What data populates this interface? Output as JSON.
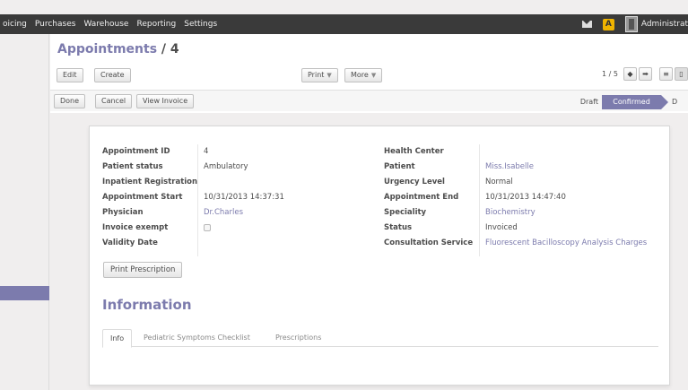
{
  "topbar": {
    "menu": [
      "oicing",
      "Purchases",
      "Warehouse",
      "Reporting",
      "Settings"
    ],
    "user": "Administrat",
    "alert_symbol": "A"
  },
  "header": {
    "title": "Appointments",
    "record": "4",
    "separator": " / ",
    "buttons": {
      "edit": "Edit",
      "create": "Create",
      "print": "Print",
      "more": "More"
    },
    "pager": "1 / 5",
    "prev_symbol": "◆",
    "next_symbol": "➡"
  },
  "statusbar": {
    "done": "Done",
    "cancel": "Cancel",
    "view_invoice": "View Invoice",
    "stages": [
      "Draft",
      "Confirmed",
      "D"
    ]
  },
  "form": {
    "left": [
      {
        "label": "Appointment ID",
        "value": "4"
      },
      {
        "label": "Patient status",
        "value": "Ambulatory"
      },
      {
        "label": "Inpatient Registration",
        "value": ""
      },
      {
        "label": "Appointment Start",
        "value": "10/31/2013 14:37:31"
      },
      {
        "label": "Physician",
        "value": "Dr.Charles"
      },
      {
        "label": "Invoice exempt",
        "value": ""
      },
      {
        "label": "Validity Date",
        "value": ""
      }
    ],
    "right": [
      {
        "label": "Health Center",
        "value": ""
      },
      {
        "label": "Patient",
        "value": "Miss.Isabelle"
      },
      {
        "label": "Urgency Level",
        "value": "Normal"
      },
      {
        "label": "Appointment End",
        "value": "10/31/2013 14:47:40"
      },
      {
        "label": "Speciality",
        "value": "Biochemistry"
      },
      {
        "label": "Status",
        "value": "Invoiced"
      },
      {
        "label": "Consultation Service",
        "value": "Fluorescent Bacilloscopy Analysis Charges"
      }
    ],
    "print_button": "Print Prescription",
    "section_title": "Information",
    "tabs": [
      "Info",
      "Pediatric Symptoms Checklist",
      "Prescriptions"
    ]
  },
  "colors": {
    "accent": "#7c7bad",
    "topbar": "#3a3a3a",
    "alert": "#f0b400"
  }
}
